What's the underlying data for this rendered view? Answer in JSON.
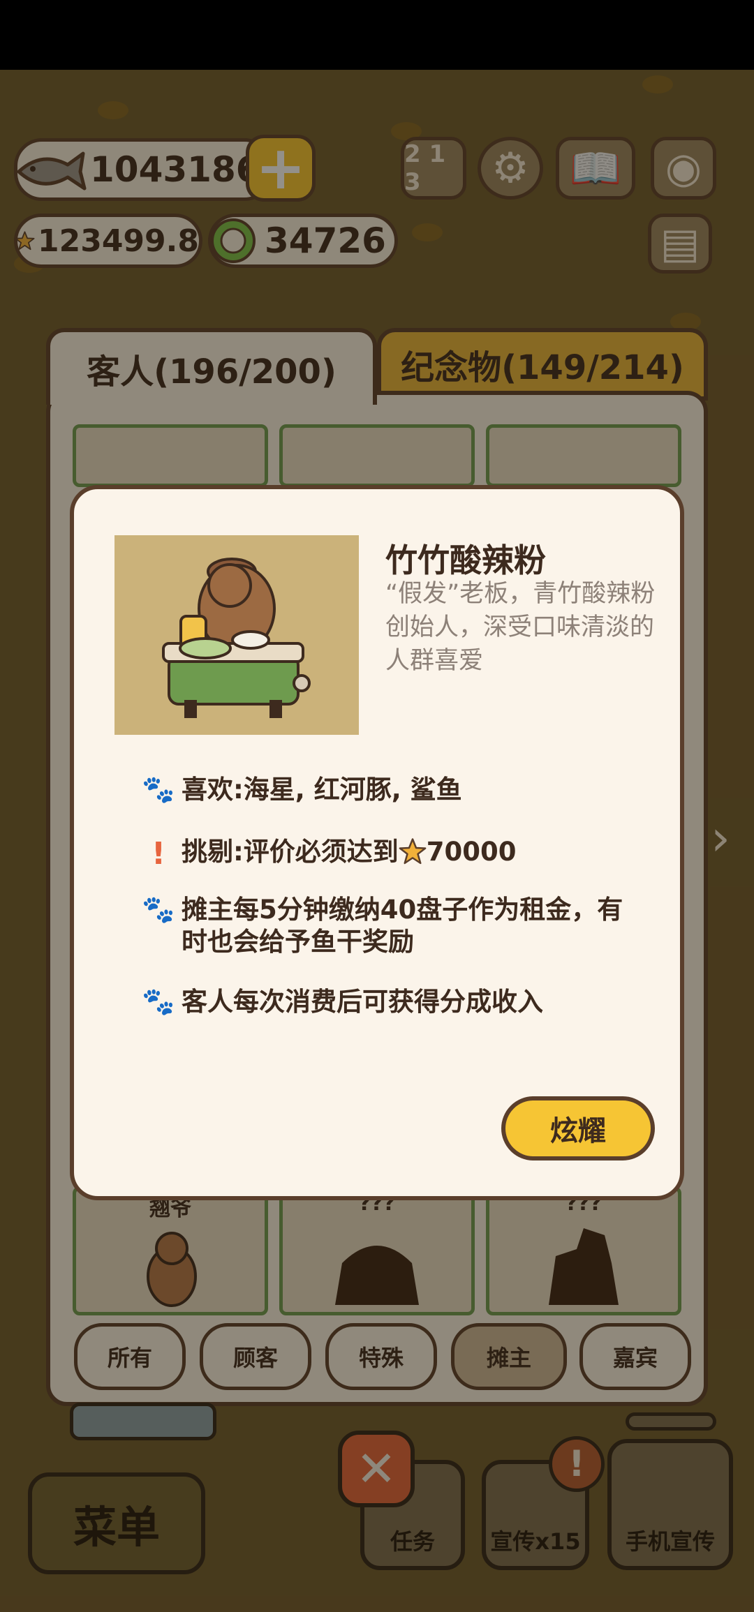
{
  "currency": {
    "fish": "1043186",
    "stars": "123499.8",
    "coins": "34726"
  },
  "icons": {
    "fish": "fish-icon",
    "plus": "plus-icon",
    "star": "star-icon",
    "coin": "coin-icon",
    "rank": "ranking-icon",
    "settings": "gear-icon",
    "book": "book-icon",
    "camera": "camera-icon",
    "news": "newspaper-icon"
  },
  "panel": {
    "tabs": [
      {
        "label": "客人(196/200)",
        "active": true
      },
      {
        "label": "纪念物(149/214)",
        "active": false
      }
    ],
    "grid_labels": [
      "翘爷",
      "???",
      "???"
    ],
    "filters": [
      {
        "label": "所有",
        "active": false
      },
      {
        "label": "顾客",
        "active": false
      },
      {
        "label": "特殊",
        "active": false
      },
      {
        "label": "摊主",
        "active": true
      },
      {
        "label": "嘉宾",
        "active": false
      }
    ]
  },
  "modal": {
    "title": "竹竹酸辣粉",
    "description": "“假发”老板，青竹酸辣粉创始人，深受口味清淡的人群喜爱",
    "likes": "喜欢:海星, 红河豚, 鲨鱼",
    "picky_prefix": "挑剔:评价必须达到",
    "picky_value": "70000",
    "rent": "摊主每5分钟缴纳40盘子作为租金，有时也会给予鱼干奖励",
    "share": "客人每次消费后可获得分成收入",
    "brag_button": "炫耀"
  },
  "bottom": {
    "menu": "菜单",
    "task": "任务",
    "promo": "宣传x15",
    "phone_promo": "手机宣传",
    "alert": "!"
  },
  "colors": {
    "accent_yellow": "#f6c534",
    "outline": "#5a3e2b",
    "panel_bg": "#f9f1e4",
    "close_red": "#e5643a"
  }
}
